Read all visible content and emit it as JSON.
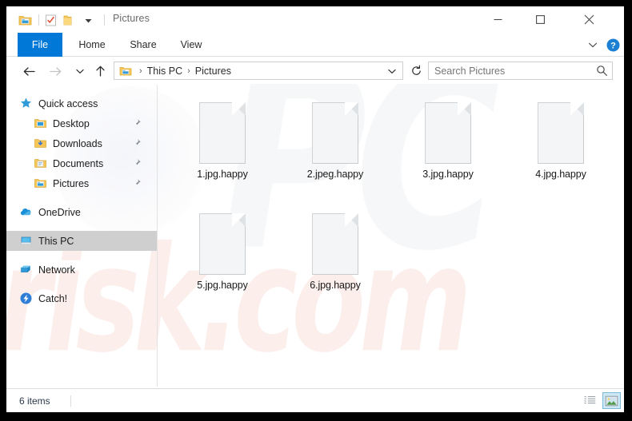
{
  "window": {
    "title": "Pictures",
    "quick_access_icons": [
      "folder-pictures-icon",
      "properties-icon",
      "new-folder-icon",
      "customize-qat-chevron-icon"
    ],
    "controls": {
      "minimize": "minimize-icon",
      "maximize": "maximize-icon",
      "close": "close-icon"
    }
  },
  "ribbon": {
    "tabs": [
      {
        "label": "File",
        "active": true
      },
      {
        "label": "Home",
        "active": false
      },
      {
        "label": "Share",
        "active": false
      },
      {
        "label": "View",
        "active": false
      }
    ],
    "expand_icon": "chevron-down-icon",
    "help_icon": "help-question-icon"
  },
  "address": {
    "back_icon": "back-arrow-icon",
    "forward_icon": "forward-arrow-icon",
    "recent_icon": "recent-locations-chevron-icon",
    "up_icon": "up-arrow-icon",
    "path_icon": "folder-pictures-icon",
    "crumbs": [
      "This PC",
      "Pictures"
    ],
    "separator": "›",
    "dropdown_icon": "chevron-down-icon",
    "refresh_icon": "refresh-icon"
  },
  "search": {
    "placeholder": "Search Pictures",
    "value": "",
    "icon": "search-icon"
  },
  "sidebar": {
    "items": [
      {
        "label": "Quick access",
        "icon": "star-icon",
        "indent": 0,
        "pinned": false,
        "selected": false
      },
      {
        "label": "Desktop",
        "icon": "folder-desktop-icon",
        "indent": 1,
        "pinned": true,
        "selected": false
      },
      {
        "label": "Downloads",
        "icon": "folder-downloads-icon",
        "indent": 1,
        "pinned": true,
        "selected": false
      },
      {
        "label": "Documents",
        "icon": "folder-documents-icon",
        "indent": 1,
        "pinned": true,
        "selected": false
      },
      {
        "label": "Pictures",
        "icon": "folder-pictures-icon",
        "indent": 1,
        "pinned": true,
        "selected": false
      },
      {
        "label": "OneDrive",
        "icon": "cloud-icon",
        "indent": 0,
        "pinned": false,
        "selected": false
      },
      {
        "label": "This PC",
        "icon": "computer-icon",
        "indent": 0,
        "pinned": false,
        "selected": true
      },
      {
        "label": "Network",
        "icon": "network-icon",
        "indent": 0,
        "pinned": false,
        "selected": false
      },
      {
        "label": "Catch!",
        "icon": "catch-app-icon",
        "indent": 0,
        "pinned": false,
        "selected": false
      }
    ]
  },
  "files": [
    {
      "name": "1.jpg.happy",
      "icon": "generic-file-icon"
    },
    {
      "name": "2.jpeg.happy",
      "icon": "generic-file-icon"
    },
    {
      "name": "3.jpg.happy",
      "icon": "generic-file-icon"
    },
    {
      "name": "4.jpg.happy",
      "icon": "generic-file-icon"
    },
    {
      "name": "5.jpg.happy",
      "icon": "generic-file-icon"
    },
    {
      "name": "6.jpg.happy",
      "icon": "generic-file-icon"
    }
  ],
  "status": {
    "count_text": "6 items",
    "view_details_icon": "details-view-icon",
    "view_large_icons_icon": "large-icons-view-icon",
    "active_view": "large-icons"
  },
  "watermark": {
    "logo_text": "PC",
    "site_text": "risk.com"
  },
  "colors": {
    "accent": "#0078d7",
    "selection": "#cfcfcf",
    "view_active_fill": "#cce8f4",
    "view_active_border": "#7eb9d6",
    "frame_border": "#000000"
  }
}
